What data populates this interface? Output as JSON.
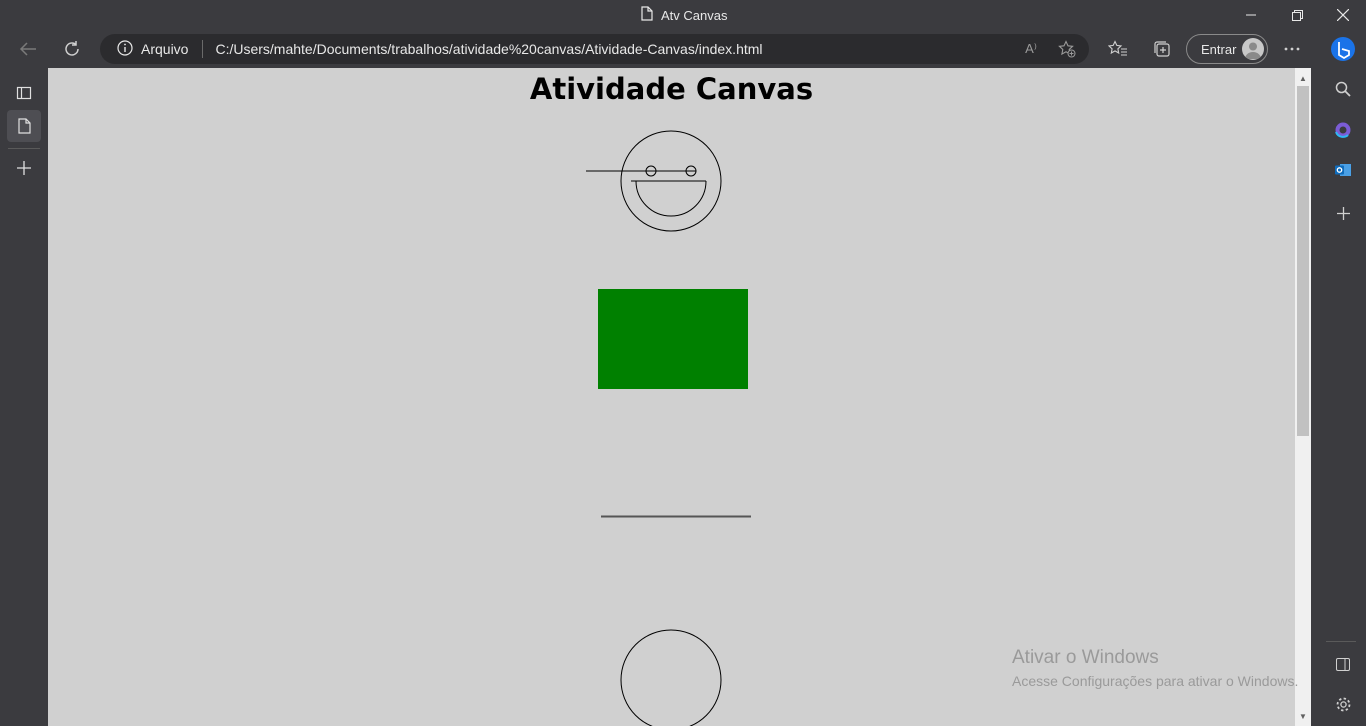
{
  "window": {
    "title": "Atv Canvas",
    "page_icon": "document-icon"
  },
  "toolbar": {
    "address_prefix": "Arquivo",
    "url": "C:/Users/mahte/Documents/trabalhos/atividade%20canvas/Atividade-Canvas/index.html",
    "signin_label": "Entrar",
    "read_aloud_glyph": "A⁾"
  },
  "page": {
    "heading": "Atividade Canvas"
  },
  "canvas_colors": {
    "background": "#d0d0d0",
    "rectangle_fill": "#008000",
    "stroke": "#000000",
    "line": "#555555"
  },
  "watermark": {
    "title": "Ativar o Windows",
    "subtitle": "Acesse Configurações para ativar o Windows."
  },
  "colors": {
    "chrome": "#3b3b3f",
    "address_bar": "#2b2b2e",
    "accent_bing": "#1a73e8"
  }
}
